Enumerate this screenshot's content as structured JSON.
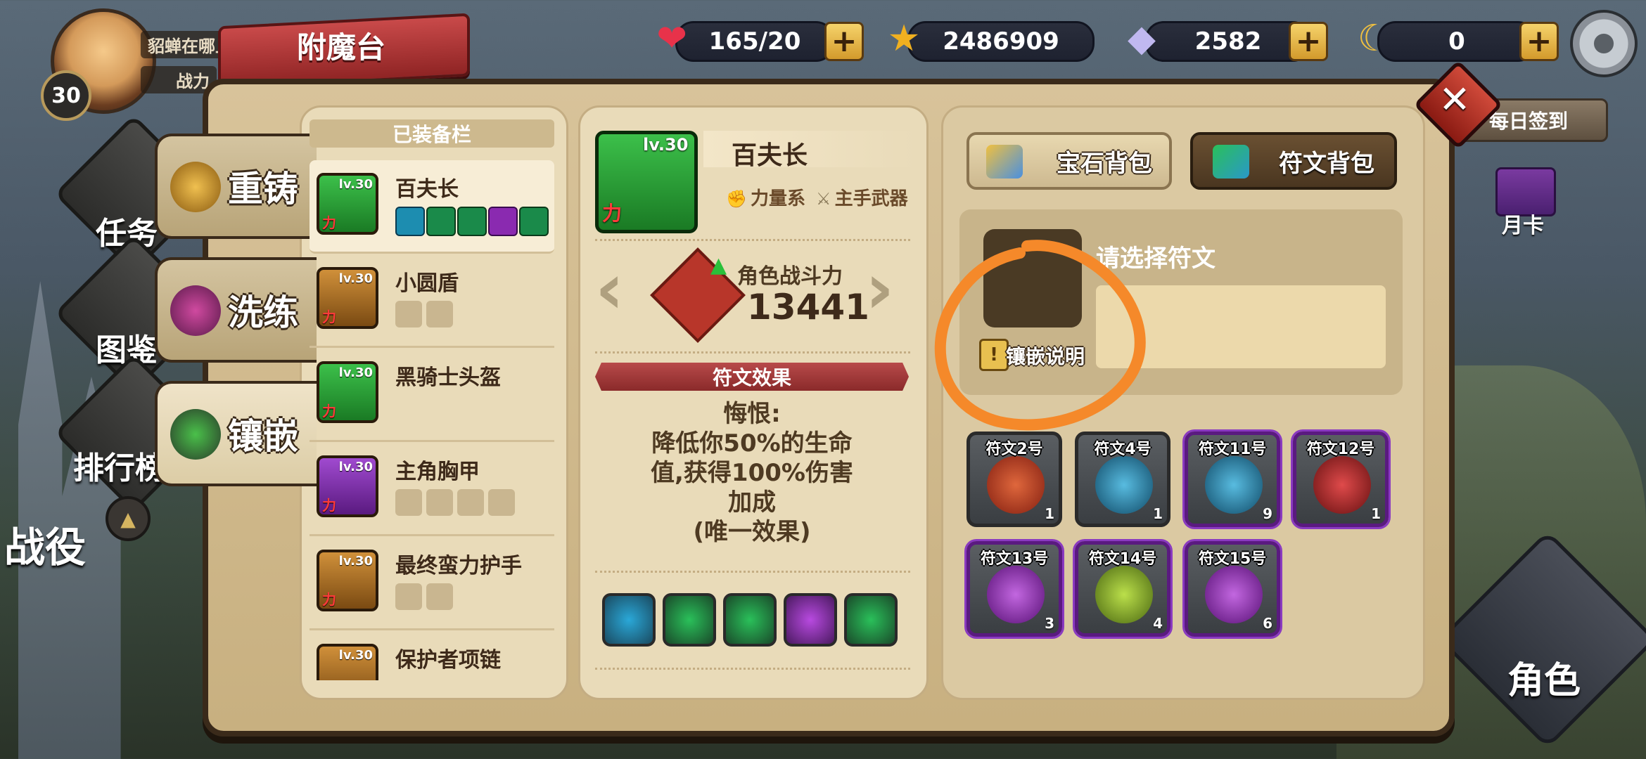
{
  "player": {
    "level": "30",
    "name": "貂蝉在哪上",
    "power_label": "战力"
  },
  "title": "附魔台",
  "resources": [
    {
      "icon": "heart-icon",
      "value": "165/20",
      "color": "#e8324a"
    },
    {
      "icon": "star-icon",
      "value": "2486909",
      "color": "#f0b020"
    },
    {
      "icon": "diamond-icon",
      "value": "2582",
      "color": "#c0b8f0"
    },
    {
      "icon": "moon-icon",
      "value": "0",
      "color": "#f0c040"
    }
  ],
  "side_menu": {
    "task": "任务",
    "codex": "图鉴",
    "rank": "排行榜",
    "battle": "战役"
  },
  "right_menu": {
    "daily_signin": "每日签到",
    "month_card": "月卡",
    "role": "角色"
  },
  "tabs": [
    {
      "label": "重铸",
      "active": false
    },
    {
      "label": "洗练",
      "active": false
    },
    {
      "label": "镶嵌",
      "active": true
    }
  ],
  "equipped": {
    "header": "已装备栏",
    "items": [
      {
        "name": "百夫长",
        "lv": "lv.30",
        "stat": "力",
        "color": "#2aa83a"
      },
      {
        "name": "小圆盾",
        "lv": "lv.30",
        "stat": "力",
        "color": "#b07a2a"
      },
      {
        "name": "黑骑士头盔",
        "lv": "lv.30",
        "stat": "力",
        "color": "#2aa83a"
      },
      {
        "name": "主角胸甲",
        "lv": "lv.30",
        "stat": "力",
        "color": "#7a2aa8"
      },
      {
        "name": "最终蛮力护手",
        "lv": "lv.30",
        "stat": "力",
        "color": "#b07a2a"
      },
      {
        "name": "保护者项链",
        "lv": "lv.30",
        "stat": "力",
        "color": "#b07a2a"
      }
    ]
  },
  "detail": {
    "lv": "lv.30",
    "stat": "力",
    "name": "百夫长",
    "tag1": "力量系",
    "tag2": "主手武器",
    "power_label": "角色战斗力",
    "power_value": "13441",
    "effect_title": "符文效果",
    "effect_lines": [
      "悔恨:",
      "降低你50%的生命",
      "值,获得100%伤害",
      "加成",
      "(唯一效果)"
    ]
  },
  "bag": {
    "gem_tab": "宝石背包",
    "rune_tab": "符文背包",
    "select_prompt": "请选择符文",
    "embed_help": "镶嵌说明",
    "runes": [
      {
        "name": "符文2号",
        "count": "1",
        "color": "#d8482a",
        "rarity": "normal"
      },
      {
        "name": "符文4号",
        "count": "1",
        "color": "#2a98c8",
        "rarity": "normal"
      },
      {
        "name": "符文11号",
        "count": "9",
        "color": "#2a98c8",
        "rarity": "epic"
      },
      {
        "name": "符文12号",
        "count": "1",
        "color": "#c82a2a",
        "rarity": "epic"
      },
      {
        "name": "符文13号",
        "count": "3",
        "color": "#a83ad8",
        "rarity": "epic"
      },
      {
        "name": "符文14号",
        "count": "4",
        "color": "#9ac82a",
        "rarity": "epic"
      },
      {
        "name": "符文15号",
        "count": "6",
        "color": "#a83ad8",
        "rarity": "epic"
      }
    ]
  },
  "annotation": {
    "color": "#f5892a"
  }
}
